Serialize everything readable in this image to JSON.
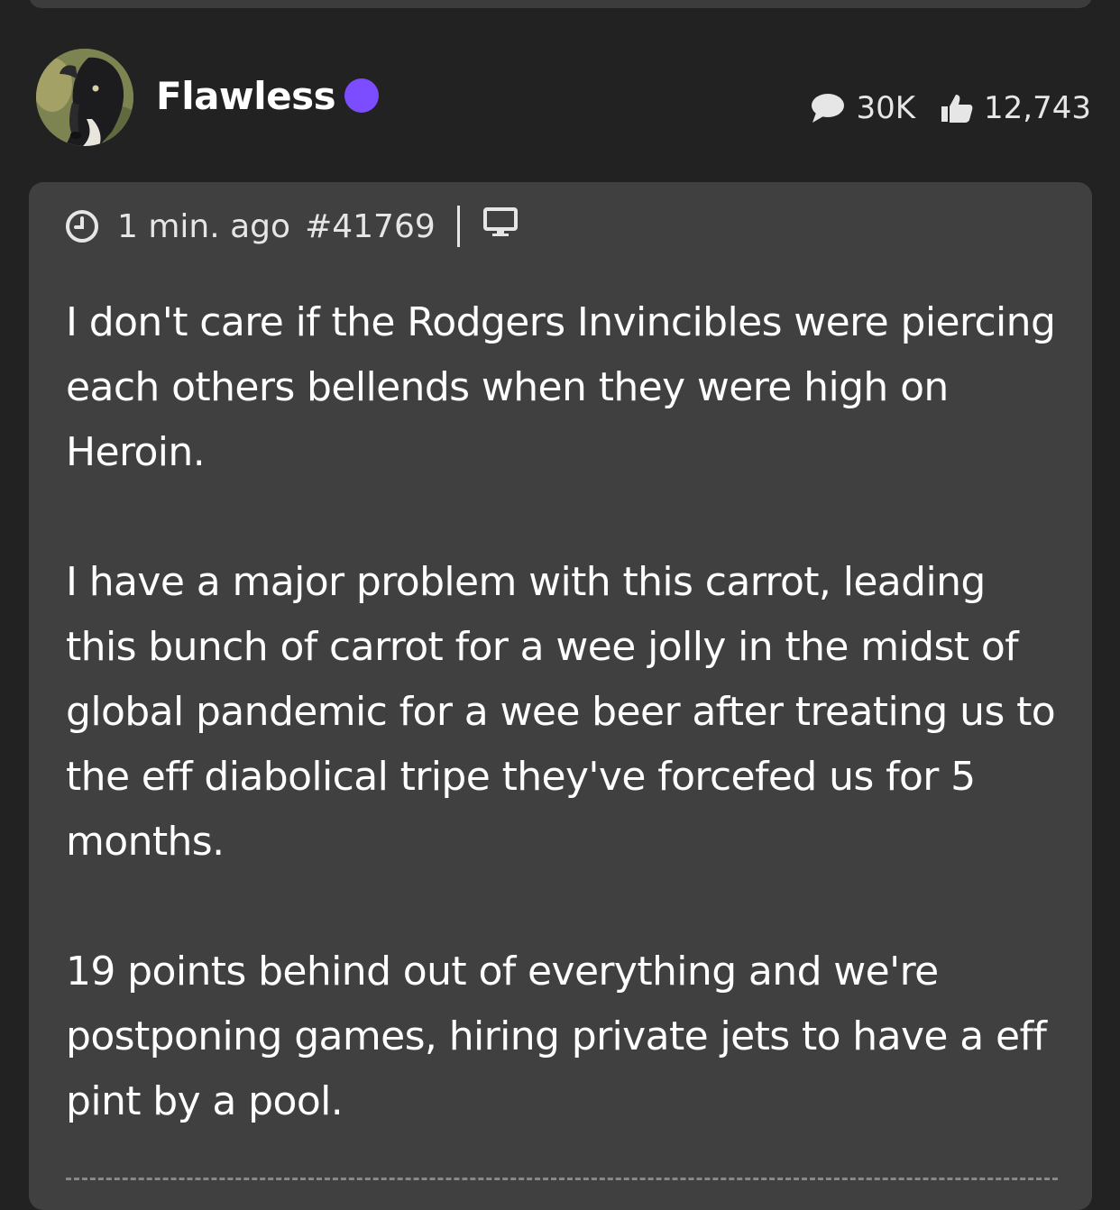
{
  "post": {
    "author": {
      "name": "Flawless",
      "avatar": "greyhound-avatar",
      "online_status_color": "#7c4dff"
    },
    "stats": {
      "comments": "30K",
      "likes": "12,743"
    },
    "meta": {
      "time": "1 min. ago",
      "id": "#41769",
      "device_icon": "desktop-icon"
    },
    "paragraphs": [
      "I don't care if the Rodgers Invincibles were piercing each others bellends when they were high on Heroin.",
      "I have a major problem with this carrot, leading this bunch of carrot for a wee jolly in the midst of global pandemic for a wee beer after treating us to the eff diabolical tripe they've forcefed us for 5 months.",
      "19 points behind out of everything and we're postponing games, hiring private jets to have a eff pint by a pool."
    ]
  },
  "colors": {
    "background": "#222222",
    "card": "#404040",
    "accent_online": "#7c4dff"
  }
}
